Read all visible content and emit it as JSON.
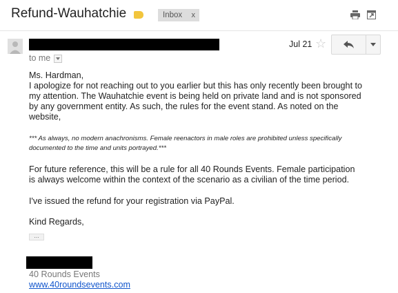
{
  "thread": {
    "subject": "Refund-Wauhatchie",
    "label": "Inbox",
    "label_remove": "x"
  },
  "toolbar": {
    "print_icon": "printer-icon",
    "newwindow_icon": "open-new-window-icon"
  },
  "message": {
    "sender_redacted": true,
    "date": "Jul 21",
    "to": "to me",
    "body": {
      "greeting": "Ms. Hardman,",
      "p1_l1": "I apologize for not reaching out to you earlier but this has only recently been brought to",
      "p1_l2": "my attention.  The Wauhatchie event is being held on private land and is not sponsored",
      "p1_l3": "by any government entity. As such, the rules for the event stand. As noted on the",
      "p1_l4": "website,",
      "note_l1": "*** As always, no modern anachronisms. Female reenactors in male roles are prohibited unless specifically",
      "note_l2": "documented to the time and units portrayed.***",
      "p2_l1": "For future reference, this will be a rule for all 40 Rounds Events.  Female participation",
      "p2_l2": "is always welcome within the context of the scenario as a civilian of the time period.",
      "p3": "I've issued the refund for your registration via PayPal.",
      "closing": "Kind Regards,",
      "trimmed": "..."
    },
    "signature": {
      "name_redacted": true,
      "org": "40 Rounds Events",
      "link": "www.40roundsevents.com"
    }
  },
  "colors": {
    "label_tag": "#f2c53d",
    "link": "#1155cc",
    "redaction": "#000000"
  }
}
